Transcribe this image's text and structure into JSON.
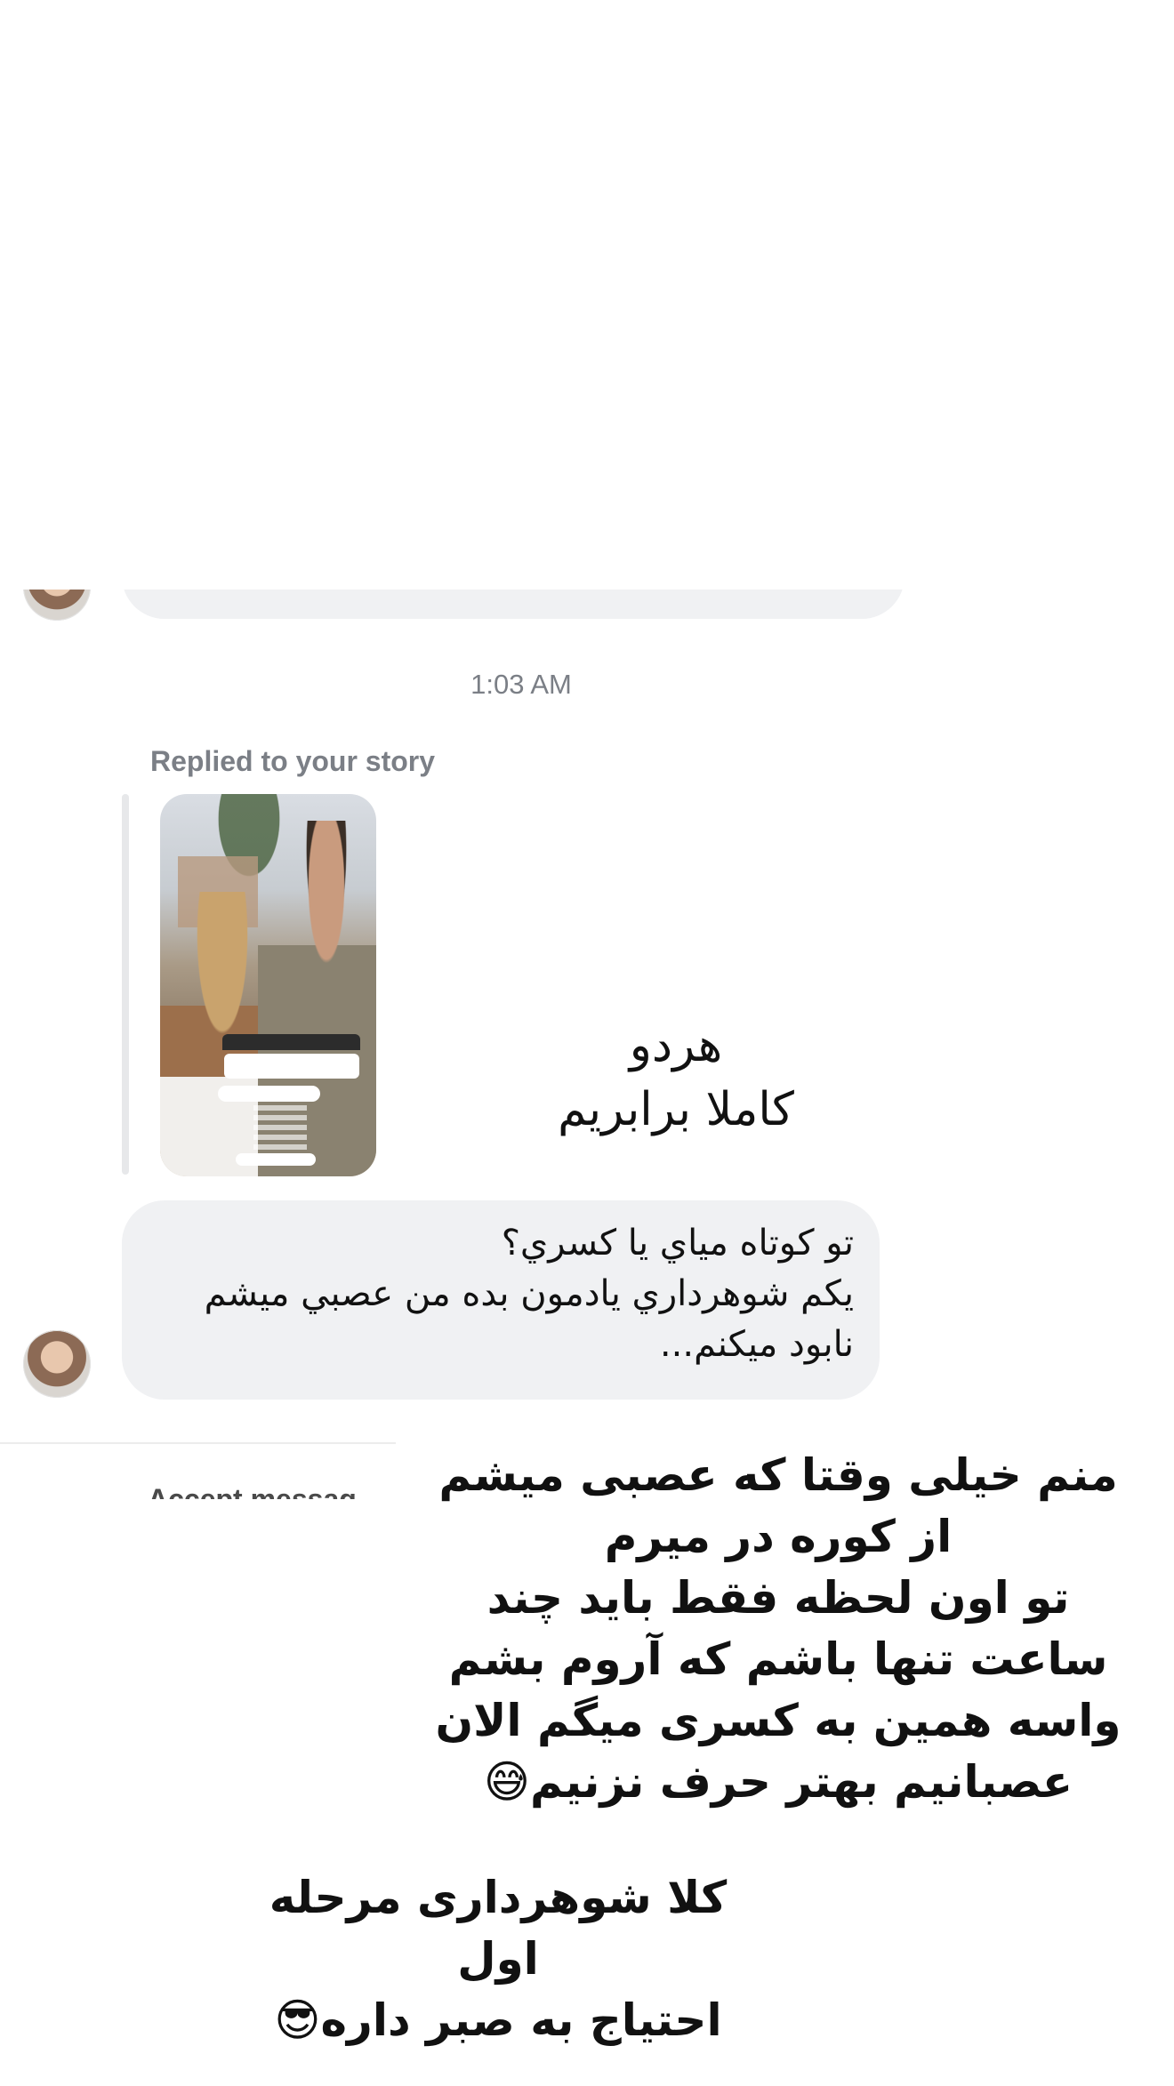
{
  "conversation": {
    "timestamp": "1:03 AM",
    "story_reply": {
      "label": "Replied to your story",
      "thumbnail_icon": "story-thumbnail-image"
    },
    "messages": [
      {
        "sender": "other",
        "text": "تو کوتاه مياي يا کسري؟\nيکم شوهرداري يادمون بده من عصبي ميشم\nنابود ميکنم..."
      }
    ],
    "accept_peek": "Accept messag"
  },
  "overlays": {
    "caption_top": "هردو\nکاملا  برابریم",
    "caption_bottom": "منم خیلی وقتا که عصبی میشم\nاز کوره در میرم\nتو اون لحظه فقط باید چند\nساعت تنها باشم که آروم بشم\nواسه همین به کسری میگم الان\nعصبانیم بهتر حرف نزنیم😅",
    "caption_final": "کلا شوهرداری مرحله اول\nاحتیاج به صبر داره😎"
  },
  "colors": {
    "bubble_bg": "#f0f1f3",
    "meta_text": "#7b7f86",
    "text": "#111111"
  }
}
